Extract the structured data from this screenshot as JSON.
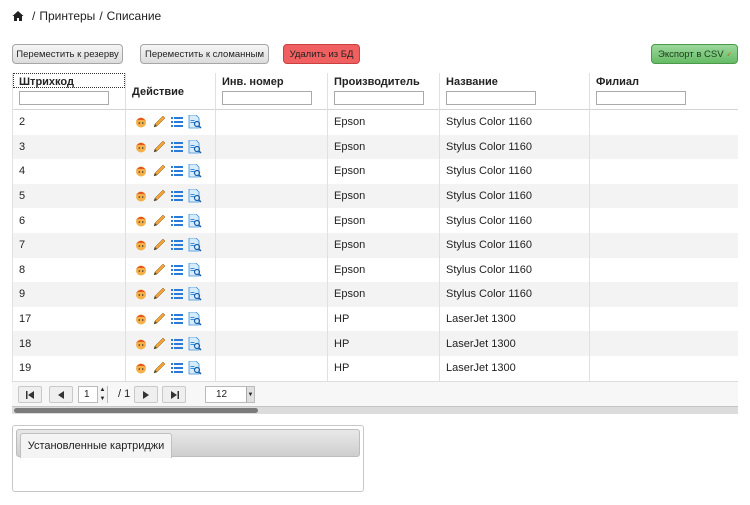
{
  "breadcrumb": {
    "home_icon": "home-icon",
    "items": [
      "Принтеры",
      "Списание"
    ],
    "separator": "/"
  },
  "toolbar": {
    "move_reserve": "Переместить к резерву",
    "move_broken": "Переместить к сломанным",
    "delete_db": "Удалить из БД",
    "export_csv": "Экспорт в CSV"
  },
  "columns": [
    "Штрихкод",
    "Действие",
    "Инв. номер",
    "Производитель",
    "Название",
    "Филиал"
  ],
  "rows": [
    {
      "barcode": "2",
      "inv": "",
      "maker": "Epson",
      "name": "Stylus Color 1160",
      "branch": ""
    },
    {
      "barcode": "3",
      "inv": "",
      "maker": "Epson",
      "name": "Stylus Color 1160",
      "branch": ""
    },
    {
      "barcode": "4",
      "inv": "",
      "maker": "Epson",
      "name": "Stylus Color 1160",
      "branch": ""
    },
    {
      "barcode": "5",
      "inv": "",
      "maker": "Epson",
      "name": "Stylus Color 1160",
      "branch": ""
    },
    {
      "barcode": "6",
      "inv": "",
      "maker": "Epson",
      "name": "Stylus Color 1160",
      "branch": ""
    },
    {
      "barcode": "7",
      "inv": "",
      "maker": "Epson",
      "name": "Stylus Color 1160",
      "branch": ""
    },
    {
      "barcode": "8",
      "inv": "",
      "maker": "Epson",
      "name": "Stylus Color 1160",
      "branch": ""
    },
    {
      "barcode": "9",
      "inv": "",
      "maker": "Epson",
      "name": "Stylus Color 1160",
      "branch": ""
    },
    {
      "barcode": "17",
      "inv": "",
      "maker": "HP",
      "name": "LaserJet 1300",
      "branch": ""
    },
    {
      "barcode": "18",
      "inv": "",
      "maker": "HP",
      "name": "LaserJet 1300",
      "branch": ""
    },
    {
      "barcode": "19",
      "inv": "",
      "maker": "HP",
      "name": "LaserJet 1300",
      "branch": ""
    }
  ],
  "row_actions": [
    "user-icon",
    "pencil-icon",
    "list-icon",
    "document-search-icon"
  ],
  "pager": {
    "page": "1",
    "total": "/ 1",
    "page_size": "12"
  },
  "tabs": [
    "Установленные картриджи"
  ],
  "colors": {
    "delete": "#f06060",
    "export": "#66bb66",
    "alt_row": "#f3f3f3"
  }
}
